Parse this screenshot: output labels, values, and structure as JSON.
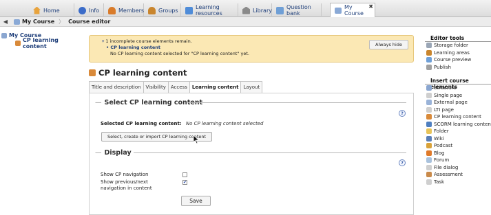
{
  "top_tabs": [
    {
      "label": "Home",
      "icon": "home-icon",
      "color": "#e8a33d"
    },
    {
      "label": "Info",
      "icon": "info-icon",
      "color": "#3b6cc9"
    },
    {
      "label": "Members",
      "icon": "members-icon",
      "color": "#d97b2a"
    },
    {
      "label": "Groups",
      "icon": "groups-icon",
      "color": "#c9852d"
    },
    {
      "label": "Learning resources",
      "icon": "learning-resources-icon",
      "color": "#4f8cd8"
    },
    {
      "label": "Library",
      "icon": "library-icon",
      "color": "#8a8a8a"
    },
    {
      "label": "Question bank",
      "icon": "question-bank-icon",
      "color": "#6f9fd6"
    },
    {
      "label": "My Course",
      "icon": "course-icon",
      "color": "#8aa9d6",
      "active": true
    }
  ],
  "breadcrumb": {
    "course": "My Course",
    "editor": "Course editor"
  },
  "tree": {
    "root": "My Course",
    "child": "CP learning content"
  },
  "notice": {
    "line1": "1 incomplete course elements remain.",
    "line2": "CP learning content",
    "line3": "No CP learning content selected for \"CP learning content\" yet.",
    "hide_label": "Always hide"
  },
  "page_title": "CP learning content",
  "subtabs": [
    "Title and description",
    "Visibility",
    "Access",
    "Learning content",
    "Layout"
  ],
  "section1": {
    "legend": "Select CP learning content",
    "field_label": "Selected CP learning content:",
    "field_value": "No CP learning content selected",
    "button": "Select, create or import CP learning content"
  },
  "section2": {
    "legend": "Display",
    "nav_label": "Show CP navigation",
    "nav_checked": false,
    "prevnext_label_1": "Show previous/next",
    "prevnext_label_2": "navigation in content",
    "prevnext_checked": true,
    "save": "Save"
  },
  "help_glyph": "?",
  "tools": {
    "editor_title": "Editor tools",
    "editor_items": [
      {
        "label": "Storage folder",
        "color": "#9aa6b6"
      },
      {
        "label": "Learning areas",
        "color": "#c9852d"
      },
      {
        "label": "Course preview",
        "color": "#6fa0d8"
      },
      {
        "label": "Publish",
        "color": "#a0a0a0"
      }
    ],
    "insert_title": "Insert course elements",
    "insert_items": [
      {
        "label": "Structure",
        "color": "#8aa6d0"
      },
      {
        "label": "Single page",
        "color": "#cfcfcf"
      },
      {
        "label": "External page",
        "color": "#9ab3d8"
      },
      {
        "label": "LTI page",
        "color": "#cfcfcf"
      },
      {
        "label": "CP learning content",
        "color": "#d98a3a"
      },
      {
        "label": "SCORM learning content",
        "color": "#4f7fc0"
      },
      {
        "label": "Folder",
        "color": "#e8c45a"
      },
      {
        "label": "Wiki",
        "color": "#5a7fb8"
      },
      {
        "label": "Podcast",
        "color": "#d9a33a"
      },
      {
        "label": "Blog",
        "color": "#e07a2a"
      },
      {
        "label": "Forum",
        "color": "#a9c2dd"
      },
      {
        "label": "File dialog",
        "color": "#cfcfcf"
      },
      {
        "label": "Assessment",
        "color": "#c98a4a"
      },
      {
        "label": "Task",
        "color": "#cfcfcf"
      }
    ]
  }
}
